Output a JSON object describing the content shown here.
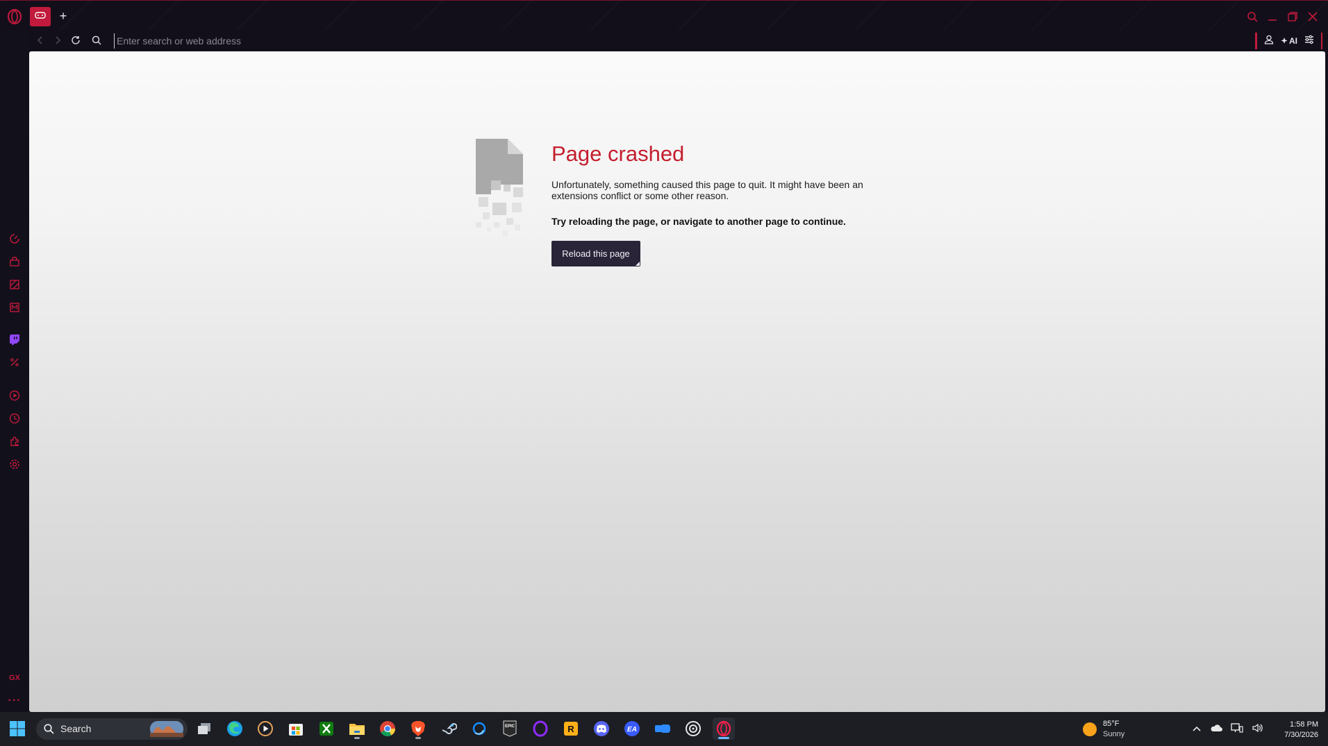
{
  "browser": {
    "tab_icon": "gx-game-controller-icon",
    "new_tab_label": "+",
    "address_placeholder": "Enter search or web address",
    "address_value": "",
    "ai_label": "AI",
    "accent_color": "#c11a3c"
  },
  "sidebar": {
    "items": [
      {
        "icon": "speed-dial-icon"
      },
      {
        "icon": "gx-corner-icon"
      },
      {
        "icon": "gx-cleaner-icon"
      },
      {
        "icon": "messenger-icon"
      },
      {
        "icon": "twitch-icon"
      },
      {
        "icon": "discount-icon"
      },
      {
        "icon": "player-icon"
      },
      {
        "icon": "history-icon"
      },
      {
        "icon": "extensions-icon"
      },
      {
        "icon": "settings-icon"
      }
    ],
    "gx_label": "GX",
    "more_label": "···"
  },
  "crash_page": {
    "title": "Page crashed",
    "description": "Unfortunately, something caused this page to quit. It might have been an extensions conflict or some other reason.",
    "hint": "Try reloading the page, or navigate to another page to continue.",
    "reload_button": "Reload this page",
    "title_color": "#c41e2e"
  },
  "taskbar": {
    "search_label": "Search",
    "apps": [
      "task-view",
      "edge",
      "media-player",
      "microsoft-store",
      "xbox",
      "file-explorer",
      "chrome",
      "brave",
      "steam",
      "battle-net",
      "epic-games",
      "opera-purple",
      "rockstar-games",
      "discord",
      "ea-app",
      "gamepass",
      "ubisoft-connect",
      "opera-gx"
    ],
    "weather": {
      "temp": "85°F",
      "condition": "Sunny"
    },
    "clock": {
      "time": "1:58 PM",
      "date": "7/30/2026"
    }
  }
}
